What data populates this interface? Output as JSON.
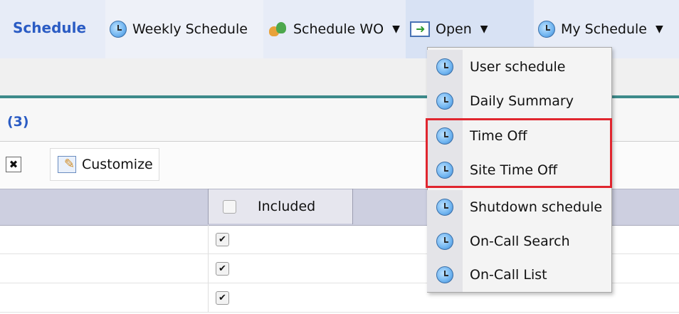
{
  "toolbar": {
    "title": "Schedule",
    "weekly_label": "Weekly Schedule",
    "wo_label": "Schedule WO",
    "open_label": "Open",
    "my_schedule_label": "My Schedule",
    "caret": "▼"
  },
  "count_label": "(3)",
  "actions": {
    "close_glyph": "✖",
    "customize_label": "Customize"
  },
  "grid": {
    "included_header": "Included",
    "rows": [
      {
        "included": true
      },
      {
        "included": true
      },
      {
        "included": true
      }
    ],
    "check_glyph": "✔"
  },
  "menu": {
    "items": [
      {
        "label": "User schedule",
        "icon": "clock-icon"
      },
      {
        "label": "Daily Summary",
        "icon": "clock-icon"
      },
      {
        "label": "Time Off",
        "icon": "clock-icon"
      },
      {
        "label": "Site Time Off",
        "icon": "clock-icon"
      },
      {
        "label": "Shutdown schedule",
        "icon": "clock-icon"
      },
      {
        "label": "On-Call Search",
        "icon": "clock-icon"
      },
      {
        "label": "On-Call List",
        "icon": "clock-icon"
      }
    ],
    "highlight_color": "#e0262f"
  },
  "colors": {
    "accent": "#2b5cc4",
    "toolbar_bg": "#e7ecf7",
    "grid_header": "#cdcfe0",
    "divider": "#3d8a8a"
  }
}
